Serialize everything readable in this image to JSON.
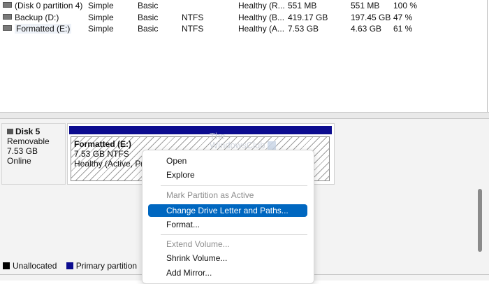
{
  "volumes": [
    {
      "name": "(Disk 0 partition 4)",
      "layout": "Simple",
      "type": "Basic",
      "fs": "",
      "status": "Healthy (R...",
      "capacity": "551 MB",
      "free": "551 MB",
      "pct": "100 %"
    },
    {
      "name": "Backup (D:)",
      "layout": "Simple",
      "type": "Basic",
      "fs": "NTFS",
      "status": "Healthy (B...",
      "capacity": "419.17 GB",
      "free": "197.45 GB",
      "pct": "47 %"
    },
    {
      "name": "Formatted (E:)",
      "layout": "Simple",
      "type": "Basic",
      "fs": "NTFS",
      "status": "Healthy (A...",
      "capacity": "7.53 GB",
      "free": "4.63 GB",
      "pct": "61 %"
    }
  ],
  "disk": {
    "title": "Disk 5",
    "kind": "Removable",
    "size": "7.53 GB",
    "state": "Online",
    "partition": {
      "name": "Formatted  (E:)",
      "size_fs": "7.53 GB NTFS",
      "status": "Healthy (Active, Prin"
    }
  },
  "watermark": {
    "line1": "The",
    "line2": "WindowsClub"
  },
  "legend": [
    {
      "label": "Unallocated",
      "color": "#000000"
    },
    {
      "label": "Primary partition",
      "color": "#0c0c8f"
    }
  ],
  "context_menu": {
    "items": [
      {
        "label": "Open",
        "state": "normal"
      },
      {
        "label": "Explore",
        "state": "normal"
      },
      {
        "label": "Mark Partition as Active",
        "state": "disabled"
      },
      {
        "label": "Change Drive Letter and Paths...",
        "state": "highlighted"
      },
      {
        "label": "Format...",
        "state": "normal"
      },
      {
        "label": "Extend Volume...",
        "state": "disabled"
      },
      {
        "label": "Shrink Volume...",
        "state": "normal"
      },
      {
        "label": "Add Mirror...",
        "state": "normal"
      }
    ]
  },
  "colors": {
    "highlight": "#0067c0",
    "primary_partition": "#0c0c8f"
  }
}
